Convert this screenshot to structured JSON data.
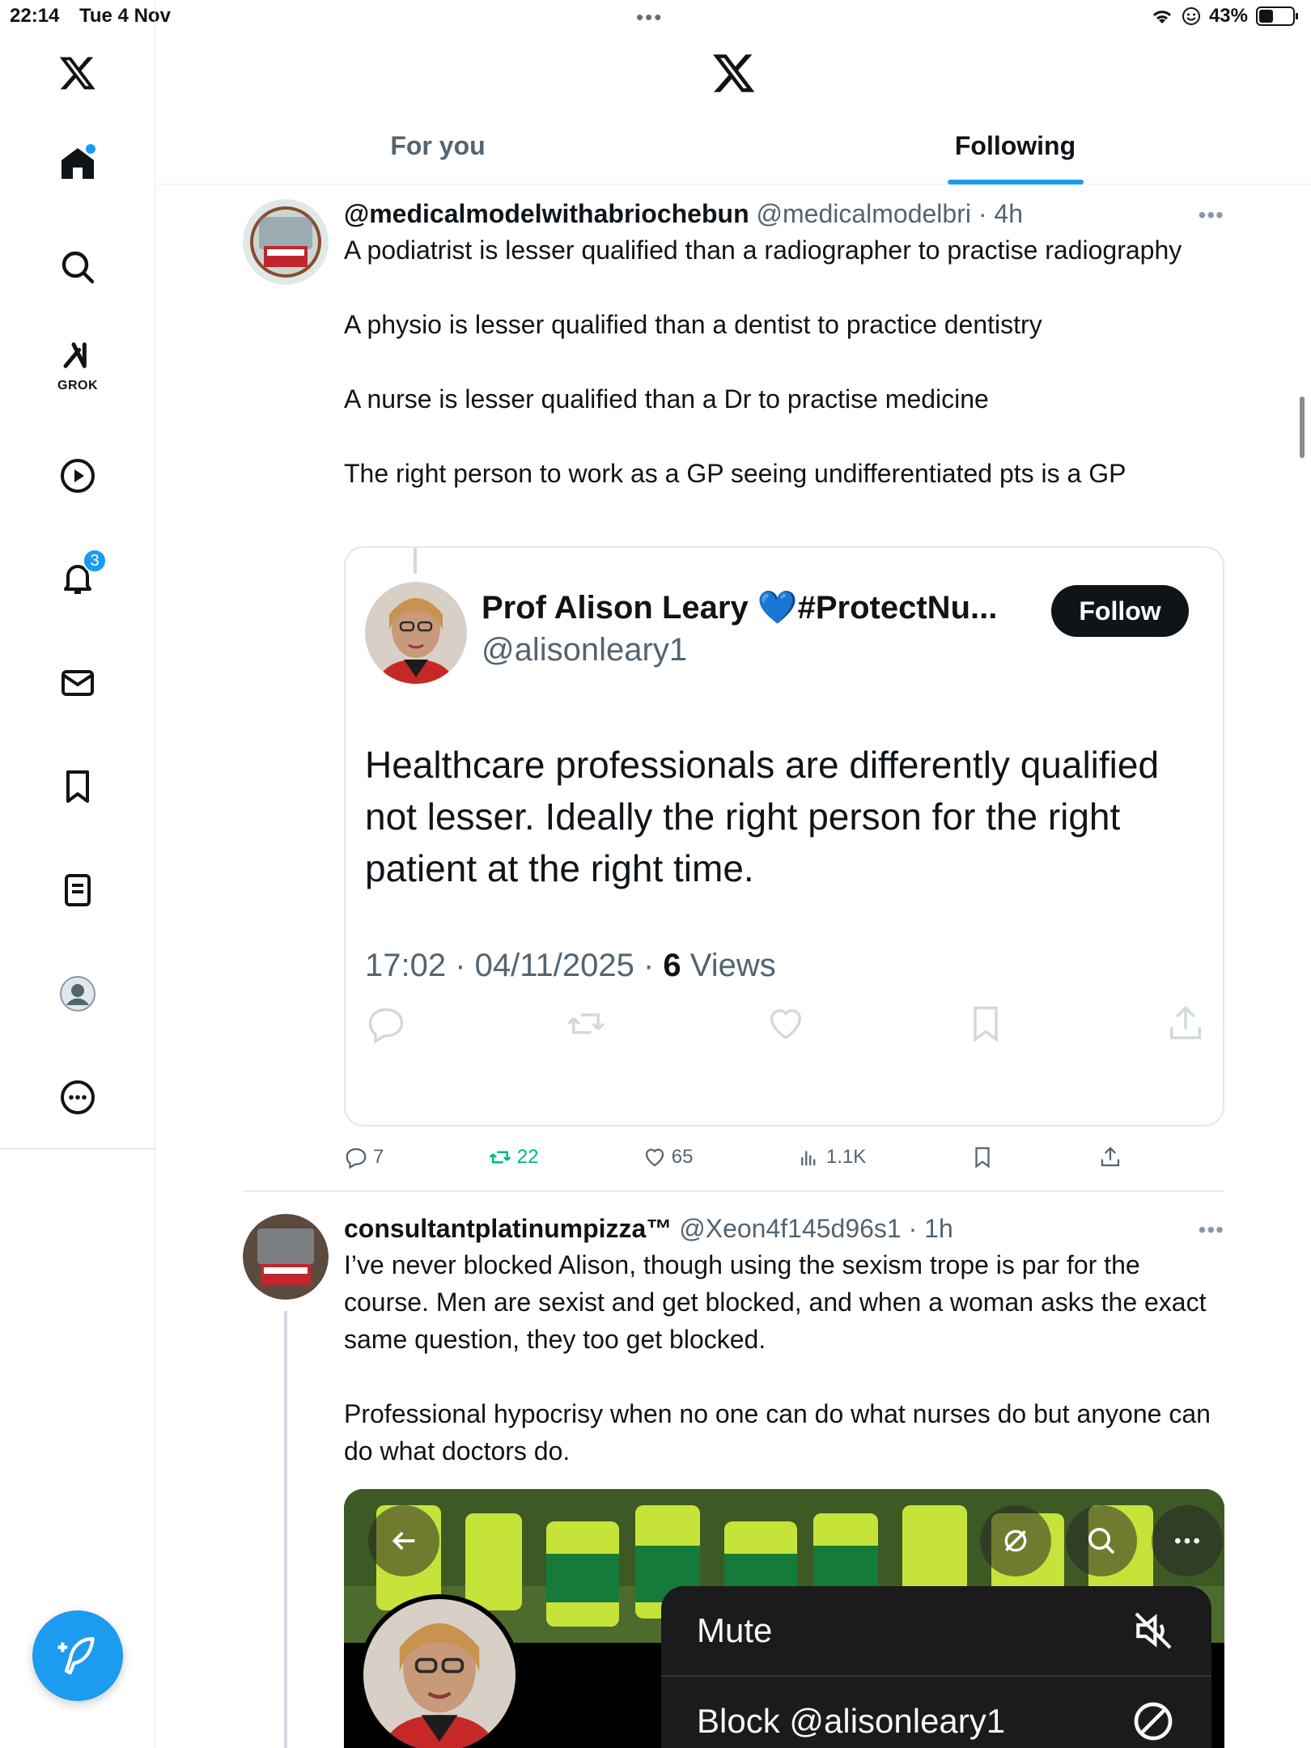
{
  "status_bar": {
    "time": "22:14",
    "date": "Tue 4 Nov",
    "battery": "43%",
    "battery_level": 0.43
  },
  "nav": {
    "notifications_badge": "3",
    "grok_label": "GROK"
  },
  "tabs": [
    {
      "label": "For you",
      "active": false
    },
    {
      "label": "Following",
      "active": true
    }
  ],
  "tweet1": {
    "name": "@medicalmodelwithabriochebun",
    "handle": "@medicalmodelbri",
    "time": "4h",
    "paragraphs": [
      "A podiatrist is lesser qualified than a radiographer to practise radiography",
      "A physio is lesser qualified than a dentist to practice dentistry",
      "A nurse is lesser qualified than a Dr to practise medicine",
      "The right person to work as a GP seeing undifferentiated pts is a GP"
    ],
    "quote": {
      "name": "Prof Alison Leary 💙#ProtectNu...",
      "handle": "@alisonleary1",
      "follow_label": "Follow",
      "text": "Healthcare professionals are differently qualified not lesser.  Ideally the right person for the right patient at the right time.",
      "timestamp": "17:02 · 04/11/2025 · ",
      "views_count": "6",
      "views_label": " Views"
    },
    "stats": {
      "replies": "7",
      "reposts": "22",
      "likes": "65",
      "views": "1.1K"
    }
  },
  "tweet2": {
    "name": "consultantplatinumpizza™",
    "handle": "@Xeon4f145d96s1",
    "time": "1h",
    "paragraphs": [
      "I’ve never blocked Alison, though using the sexism trope is par for the course. Men are sexist and get blocked, and when a woman asks the exact same question, they too get blocked.",
      "Professional hypocrisy when no one can do what nurses do but anyone can do what doctors do."
    ]
  },
  "context_menu": {
    "items": [
      {
        "label": "Mute",
        "icon": "mute-icon"
      },
      {
        "label": "Block @alisonleary1",
        "icon": "block-icon"
      }
    ]
  },
  "colors": {
    "accent": "#1d9bf0",
    "repost_green": "#00ba7c",
    "text_primary": "#0f1419",
    "text_secondary": "#536471"
  }
}
